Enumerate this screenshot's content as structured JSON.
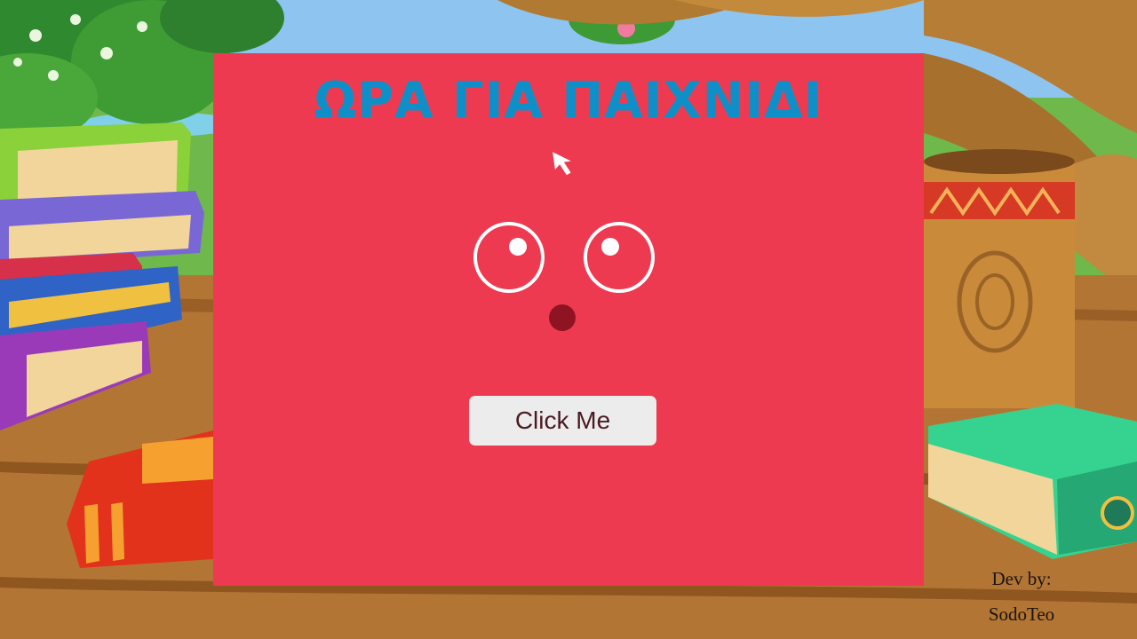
{
  "game": {
    "title": "ΩΡΑ ΓΙΑ ΠΑΙΧΝΙΔΙ",
    "button_label": "Click Me",
    "colors": {
      "panel_background": "#ee3a50",
      "title": "#0f8fc8",
      "eyes": "#ffffff",
      "nose": "#8e1423",
      "button_background": "#ececec",
      "button_text": "#4a1a22"
    },
    "icons": [
      "mouse-cursor-icon"
    ]
  },
  "credits": {
    "line1": "Dev by:",
    "line2": "SodoTeo"
  }
}
